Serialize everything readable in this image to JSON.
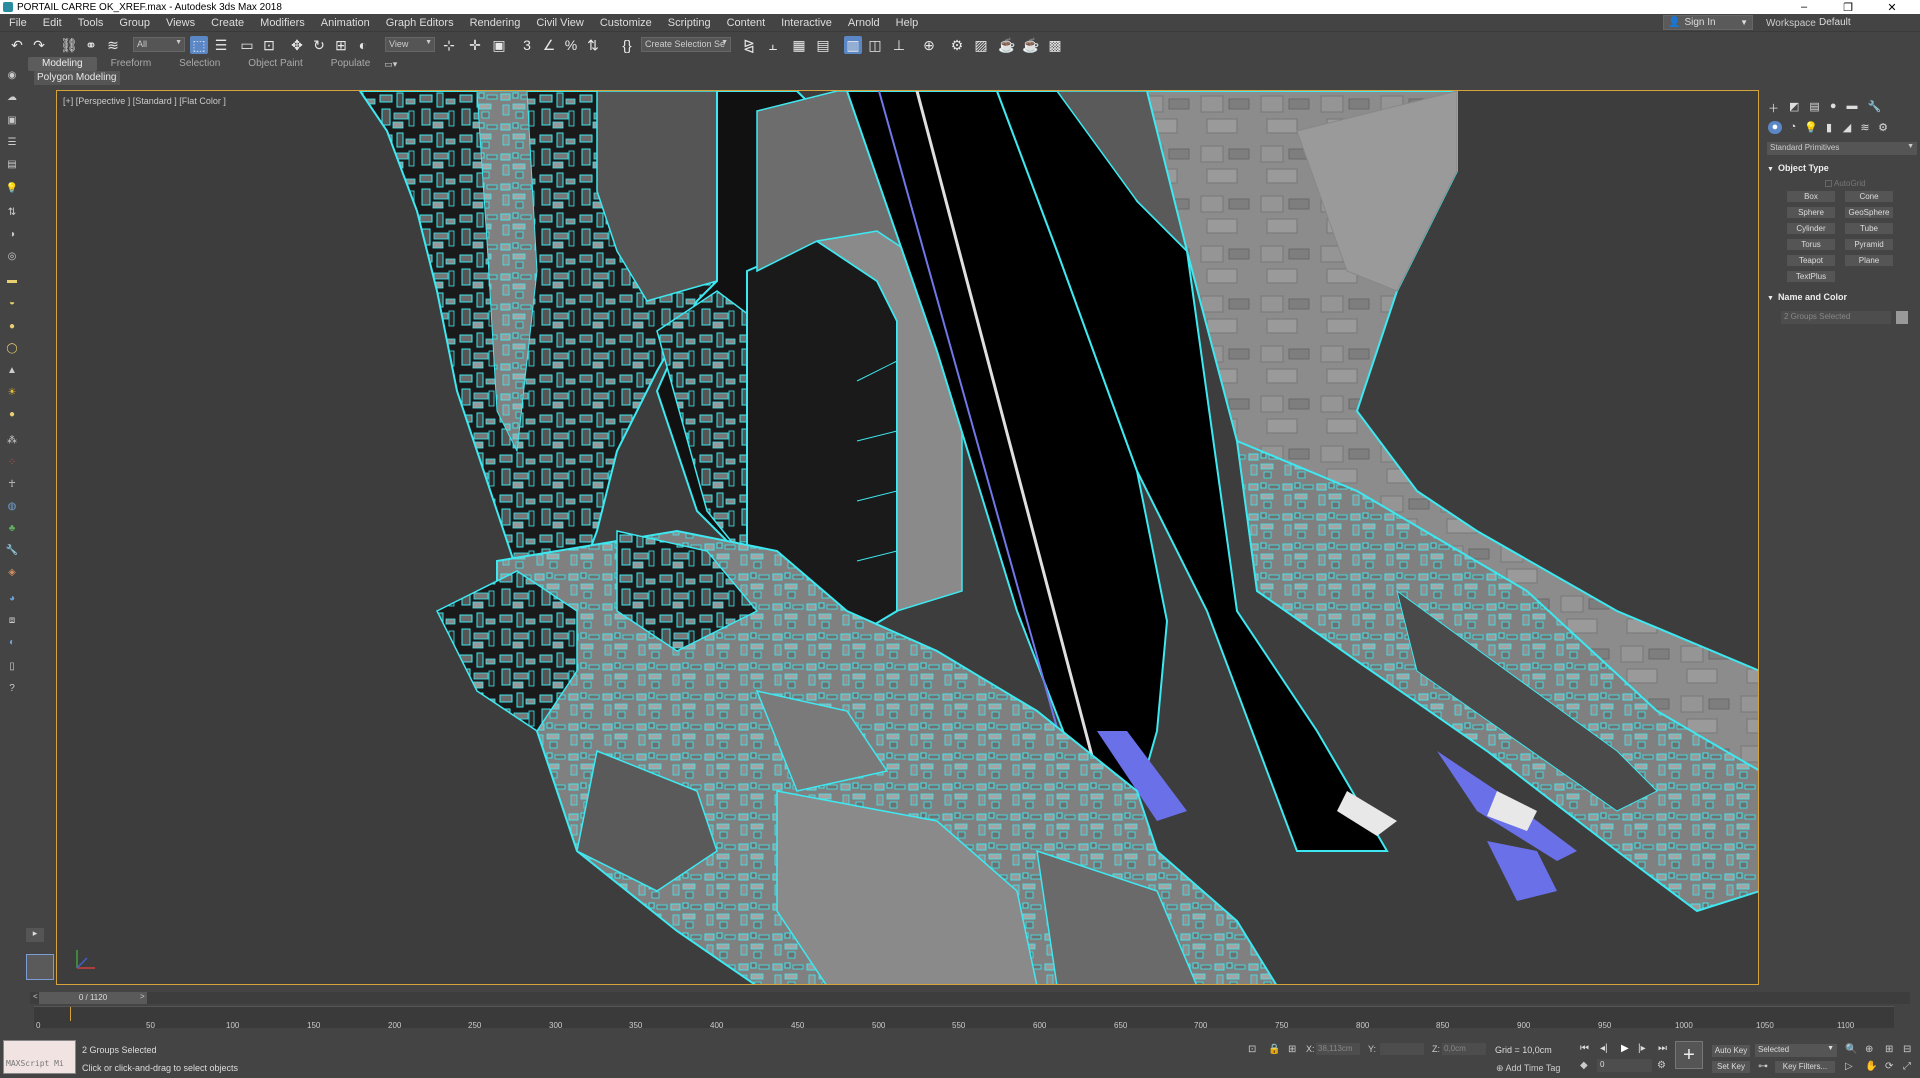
{
  "window": {
    "title": "PORTAIL CARRE OK_XREF.max - Autodesk 3ds Max 2018",
    "minimize": "–",
    "restore": "❐",
    "close": "✕"
  },
  "menu": [
    "File",
    "Edit",
    "Tools",
    "Group",
    "Views",
    "Create",
    "Modifiers",
    "Animation",
    "Graph Editors",
    "Rendering",
    "Civil View",
    "Customize",
    "Scripting",
    "Content",
    "Interactive",
    "Arnold",
    "Help"
  ],
  "account": {
    "sign_in": "Sign In",
    "workspaces_label": "Workspaces:",
    "workspace": "Default"
  },
  "toolbar": {
    "filter": "All",
    "ref_coord": "View",
    "named_selection": "Create Selection Se"
  },
  "ribbon": {
    "tabs": [
      "Modeling",
      "Freeform",
      "Selection",
      "Object Paint",
      "Populate"
    ],
    "active_tab": "Modeling",
    "sub": "Polygon Modeling"
  },
  "viewport": {
    "label": "[+] [Perspective ] [Standard ] [Flat Color ]",
    "highlight_color": "#3ee8f0",
    "border_color": "#d6a23b"
  },
  "command_panel": {
    "category": "Standard Primitives",
    "object_type_title": "Object Type",
    "autogrid": "AutoGrid",
    "primitives": [
      "Box",
      "Cone",
      "Sphere",
      "GeoSphere",
      "Cylinder",
      "Tube",
      "Torus",
      "Pyramid",
      "Teapot",
      "Plane",
      "TextPlus"
    ],
    "name_color_title": "Name and Color",
    "name_field": "2 Groups Selected"
  },
  "timeline": {
    "slider": "0 / 1120",
    "ticks": [
      "0",
      "50",
      "100",
      "150",
      "200",
      "250",
      "300",
      "350",
      "400",
      "450",
      "500",
      "550",
      "600",
      "650",
      "700",
      "750",
      "800",
      "850",
      "900",
      "950",
      "1000",
      "1050",
      "1100"
    ]
  },
  "status": {
    "maxscript": "MAXScript Mi",
    "selection": "2 Groups Selected",
    "prompt": "Click or click-and-drag to select objects",
    "x_label": "X:",
    "x_value": "38,113cm",
    "y_label": "Y:",
    "y_value": "",
    "z_label": "Z:",
    "z_value": "0,0cm",
    "grid": "Grid = 10,0cm",
    "add_time_tag": "Add Time Tag",
    "auto_key": "Auto Key",
    "set_key": "Set Key",
    "selected": "Selected",
    "key_filters": "Key Filters...",
    "frame": "0"
  }
}
